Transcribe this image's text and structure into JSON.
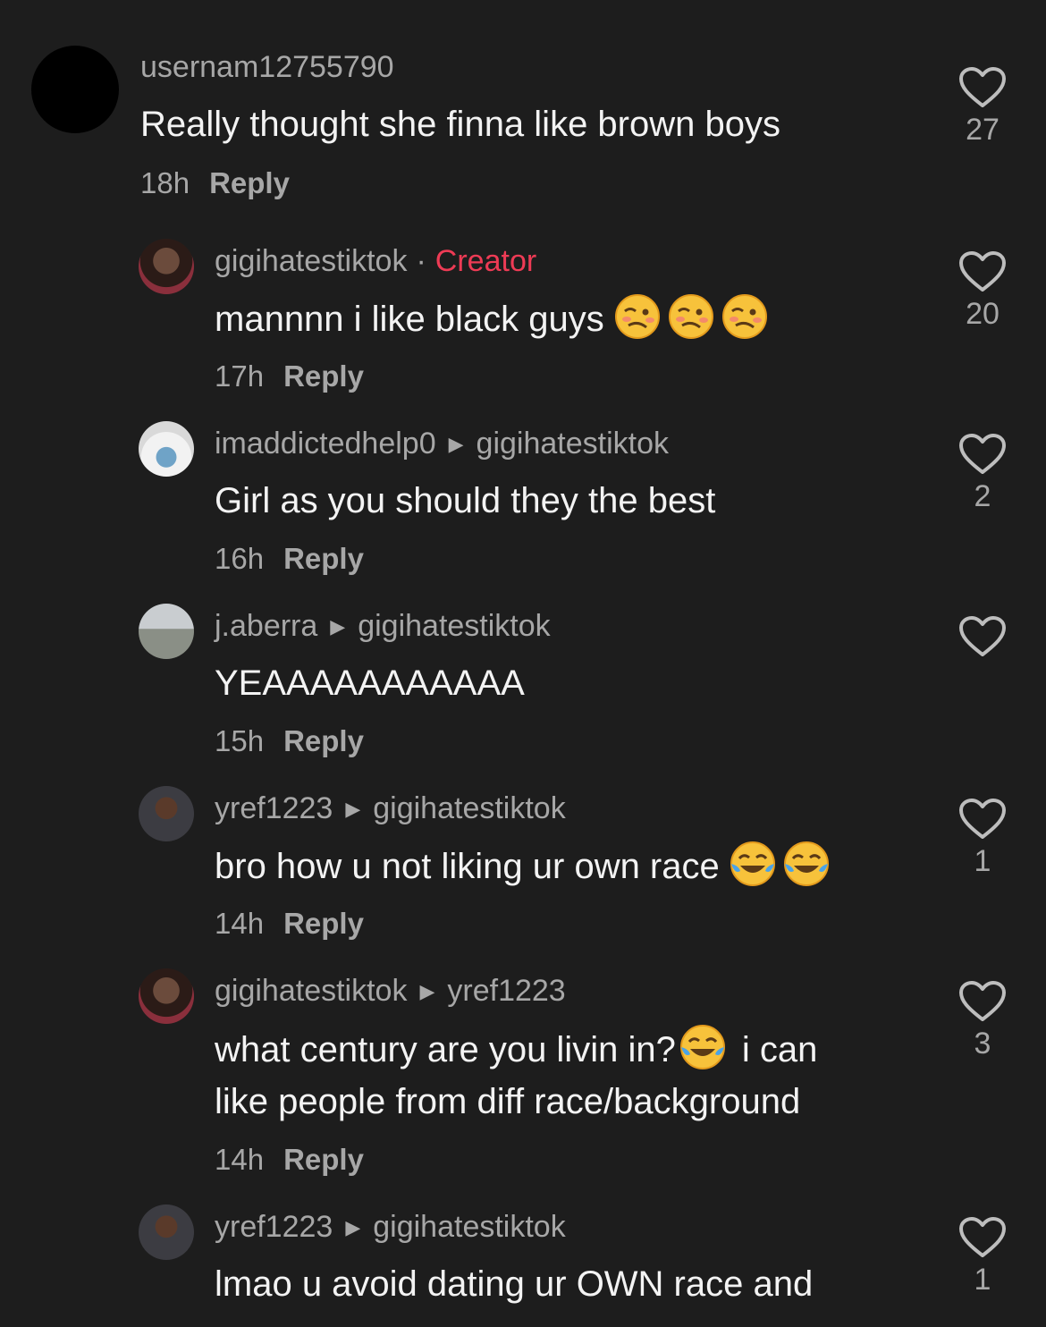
{
  "comments": [
    {
      "user": "usernam12755790",
      "text": "Really thought she finna like brown boys",
      "time": "18h",
      "reply": "Reply",
      "likes": "27"
    },
    {
      "user": "gigihatestiktok",
      "badge_sep": "·",
      "badge": "Creator",
      "text": "mannnn i like black guys",
      "time": "17h",
      "reply": "Reply",
      "likes": "20"
    },
    {
      "user": "imaddictedhelp0",
      "to": "gigihatestiktok",
      "text": "Girl as you should they the best",
      "time": "16h",
      "reply": "Reply",
      "likes": "2"
    },
    {
      "user": "j.aberra",
      "to": "gigihatestiktok",
      "text": "YEAAAAAAAAAAA",
      "time": "15h",
      "reply": "Reply",
      "likes": ""
    },
    {
      "user": "yref1223",
      "to": "gigihatestiktok",
      "text": "bro how u not liking ur own race",
      "time": "14h",
      "reply": "Reply",
      "likes": "1"
    },
    {
      "user": "gigihatestiktok",
      "to": "yref1223",
      "text": "what century are you livin in?",
      "text_after": "i can",
      "text2": "like people from diff race/background",
      "time": "14h",
      "reply": "Reply",
      "likes": "3"
    },
    {
      "user": "yref1223",
      "to": "gigihatestiktok",
      "text": "lmao u avoid dating ur OWN race and",
      "likes": "1"
    }
  ]
}
